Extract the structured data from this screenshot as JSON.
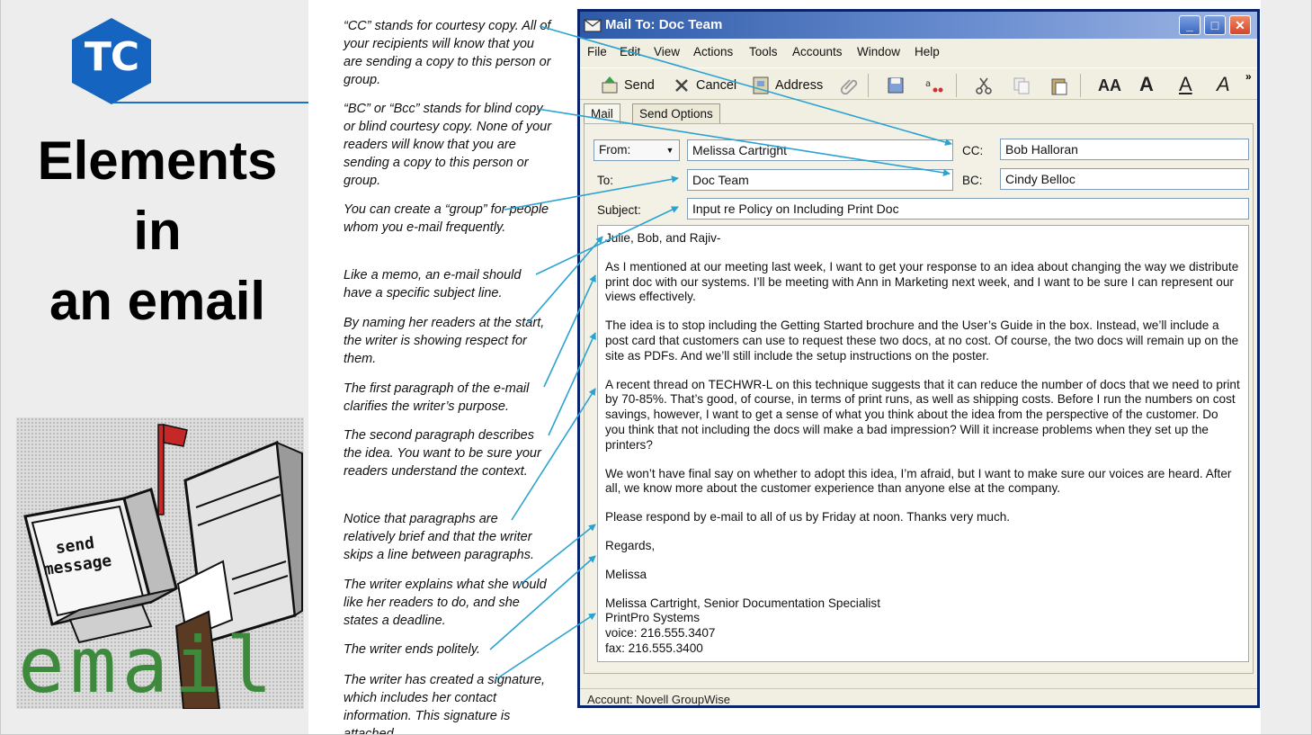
{
  "slide": {
    "logo_text": "TC",
    "title_lines": [
      "Elements",
      "in",
      "an email"
    ],
    "clipart": {
      "send_line1": "send",
      "send_line2": "message",
      "email_word": "email"
    }
  },
  "annotations": [
    "“CC” stands for courtesy copy. All of your recipients will know that you are sending a copy to this person or group.",
    "“BC” or “Bcc” stands for blind copy or blind courtesy copy. None of your readers will know that you are sending a copy to this person or group.",
    "You can create a “group” for people whom you e-mail frequently.",
    "Like a memo, an e-mail should have a specific subject line.",
    "By naming her readers at the start, the writer is showing respect for them.",
    "The first paragraph of the e-mail clarifies the writer’s purpose.",
    "The second paragraph describes the idea. You want to be sure your readers understand the context.",
    "Notice that paragraphs are relatively brief and that the writer skips a line between paragraphs.",
    "The writer explains what she would like her readers to do, and she states a deadline.",
    "The writer ends politely.",
    "The writer has created a signature, which includes her contact information. This signature is attached"
  ],
  "window": {
    "title": "Mail To: Doc Team",
    "controls": {
      "minimize": "_",
      "maximize": "□",
      "close": "✕"
    },
    "menu": [
      "File",
      "Edit",
      "View",
      "Actions",
      "Tools",
      "Accounts",
      "Window",
      "Help"
    ],
    "toolbar": {
      "send": "Send",
      "cancel": "Cancel",
      "address": "Address",
      "font_buttons": [
        "AA",
        "A",
        "A",
        "A"
      ],
      "overflow": "»"
    },
    "tabs": [
      "Mail",
      "Send Options"
    ],
    "fields": {
      "from_label": "From:",
      "from_value": "Melissa Cartright",
      "to_label": "To:",
      "to_value": "Doc Team",
      "subject_label": "Subject:",
      "subject_value": "Input re Policy on Including Print Doc",
      "cc_label": "CC:",
      "cc_value": "Bob Halloran",
      "bc_label": "BC:",
      "bc_value": "Cindy Belloc"
    },
    "body": {
      "greeting": "Julie, Bob, and Rajiv-",
      "paragraphs": [
        "As I mentioned at our meeting last week, I want to get your response to an idea about changing the way we distribute print doc with our systems. I’ll be meeting with Ann in Marketing next week, and I want to be sure I can represent our views effectively.",
        "The idea is to stop including the Getting Started brochure and the User’s Guide in the box. Instead, we’ll include a post card that customers can use to request these two docs, at no cost. Of course, the two docs will remain up on the site as PDFs. And we’ll still include the setup instructions on the poster.",
        "A recent thread on TECHWR-L on this technique suggests that it can reduce the number of docs that we need to print by 70-85%. That’s good, of course, in terms of print runs, as well as shipping costs. Before I run the numbers on cost savings, however, I want to get a sense of what you think about the idea from the perspective of the customer. Do you think that not including the docs will make a bad impression? Will it increase problems when they set up the printers?",
        "We won’t have final say on whether to adopt this idea, I’m afraid, but I want to make sure our voices are heard. After all, we know more about the customer experience than anyone else at the company.",
        "Please respond by e-mail to all of us by Friday at noon. Thanks very much."
      ],
      "closing": "Regards,",
      "name": "Melissa",
      "signature": [
        "Melissa Cartright, Senior Documentation Specialist",
        "PrintPro Systems",
        "voice: 216.555.3407",
        "fax: 216.555.3400"
      ]
    },
    "status": "Account: Novell GroupWise"
  },
  "colors": {
    "logo_blue": "#1565c0",
    "title_bar": "#2d5aa8",
    "arrow": "#29a3d1",
    "email_green": "#3e8a3c"
  }
}
